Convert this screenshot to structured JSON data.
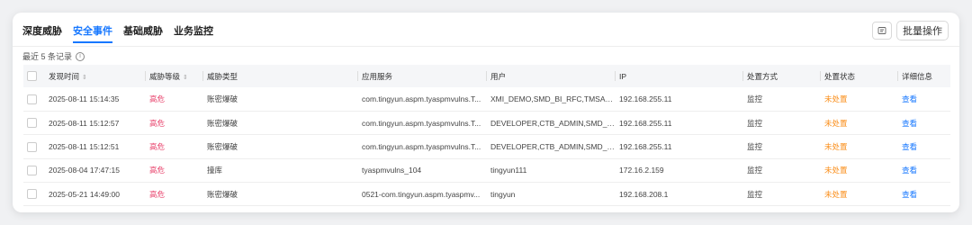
{
  "tabs": [
    {
      "label": "深度威胁"
    },
    {
      "label": "安全事件"
    },
    {
      "label": "基础威胁"
    },
    {
      "label": "业务监控"
    }
  ],
  "toolbar": {
    "bulk_label": "批量操作",
    "export_icon": "export-icon"
  },
  "records_note": "最近 5 条记录",
  "columns": [
    "发现时间",
    "威胁等级",
    "威胁类型",
    "应用服务",
    "用户",
    "IP",
    "处置方式",
    "处置状态",
    "详细信息"
  ],
  "colors": {
    "accent": "#1677ff",
    "high": "#e8436c",
    "pending": "#fa8c16"
  },
  "rows": [
    {
      "time": "2025-08-11 15:14:35",
      "level": "高危",
      "type": "账密爆破",
      "service": "com.tingyun.aspm.tyaspmvulns.T...",
      "user": "XMI_DEMO,SMD_BI_RFC,TMSAD...",
      "ip": "192.168.255.11",
      "method": "监控",
      "status": "未处置",
      "detail": "查看"
    },
    {
      "time": "2025-08-11 15:12:57",
      "level": "高危",
      "type": "账密爆破",
      "service": "com.tingyun.aspm.tyaspmvulns.T...",
      "user": "DEVELOPER,CTB_ADMIN,SMD_A...",
      "ip": "192.168.255.11",
      "method": "监控",
      "status": "未处置",
      "detail": "查看"
    },
    {
      "time": "2025-08-11 15:12:51",
      "level": "高危",
      "type": "账密爆破",
      "service": "com.tingyun.aspm.tyaspmvulns.T...",
      "user": "DEVELOPER,CTB_ADMIN,SMD_A...",
      "ip": "192.168.255.11",
      "method": "监控",
      "status": "未处置",
      "detail": "查看"
    },
    {
      "time": "2025-08-04 17:47:15",
      "level": "高危",
      "type": "撞库",
      "service": "tyaspmvulns_104",
      "user": "tingyun111",
      "ip": "172.16.2.159",
      "method": "监控",
      "status": "未处置",
      "detail": "查看"
    },
    {
      "time": "2025-05-21 14:49:00",
      "level": "高危",
      "type": "账密爆破",
      "service": "0521-com.tingyun.aspm.tyaspmv...",
      "user": "tingyun",
      "ip": "192.168.208.1",
      "method": "监控",
      "status": "未处置",
      "detail": "查看"
    }
  ]
}
